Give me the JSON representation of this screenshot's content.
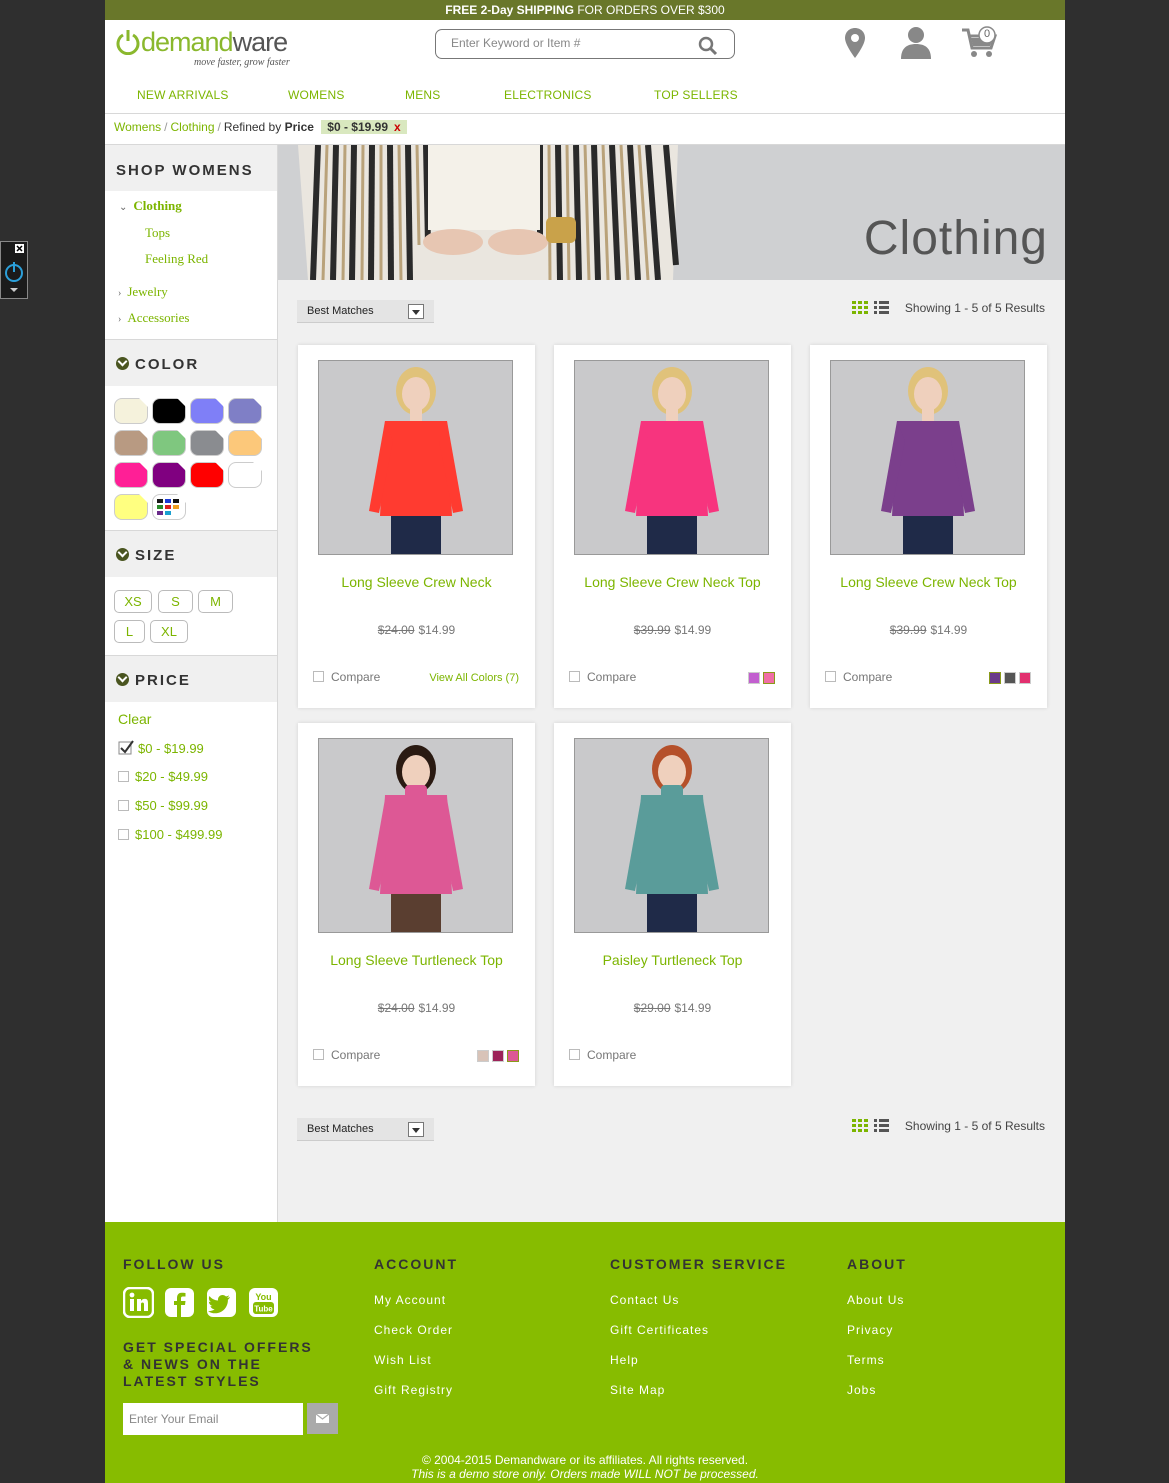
{
  "promo": {
    "bold": "FREE 2-Day SHIPPING",
    "rest": " FOR ORDERS OVER $300"
  },
  "logo": {
    "word_a": "demand",
    "word_b": "ware",
    "tagline": "move faster, grow faster"
  },
  "search": {
    "placeholder": "Enter Keyword or Item #"
  },
  "cart": {
    "count": "0"
  },
  "nav": [
    "NEW ARRIVALS",
    "WOMENS",
    "MENS",
    "ELECTRONICS",
    "TOP SELLERS"
  ],
  "breadcrumb": {
    "items": [
      "Womens",
      "Clothing"
    ],
    "refined_prefix": "Refined by",
    "refined_label": "Price",
    "chip": "$0 - $19.99",
    "chip_remove": "x"
  },
  "sidebar": {
    "shop_title": "SHOP WOMENS",
    "categories": [
      {
        "label": "Clothing",
        "expanded": true
      },
      {
        "label": "Tops"
      },
      {
        "label": "Feeling Red"
      },
      {
        "label": "Jewelry"
      },
      {
        "label": "Accessories"
      }
    ],
    "color_title": "COLOR",
    "colors": [
      "#f5f2dc",
      "#000000",
      "#7f7ff7",
      "#7f7fc6",
      "#b89a82",
      "#7fc77f",
      "#8a8c90",
      "#fcc87a",
      "#ff1f96",
      "#800080",
      "#ff0000",
      "#ffffff",
      "#ffff80",
      "multi"
    ],
    "size_title": "SIZE",
    "sizes": [
      "XS",
      "S",
      "M",
      "L",
      "XL"
    ],
    "price_title": "PRICE",
    "price_clear": "Clear",
    "prices": [
      {
        "label": "$0 - $19.99",
        "checked": true
      },
      {
        "label": "$20 - $49.99",
        "checked": false
      },
      {
        "label": "$50 - $99.99",
        "checked": false
      },
      {
        "label": "$100 - $499.99",
        "checked": false
      }
    ]
  },
  "banner": {
    "title": "Clothing"
  },
  "toolbar": {
    "sort": "Best Matches",
    "results": "Showing 1 - 5 of 5 Results"
  },
  "products": [
    {
      "name": "Long Sleeve Crew Neck",
      "old": "$24.00",
      "price": "$14.99",
      "compare": "Compare",
      "view_all": "View All Colors (7)",
      "swatches": [],
      "shirt": "#ff3b30"
    },
    {
      "name": "Long Sleeve Crew Neck Top",
      "old": "$39.99",
      "price": "$14.99",
      "compare": "Compare",
      "view_all": "",
      "swatches": [
        "#c25fcf",
        "#f06ea6"
      ],
      "shirt": "#f7347e"
    },
    {
      "name": "Long Sleeve Crew Neck Top",
      "old": "$39.99",
      "price": "$14.99",
      "compare": "Compare",
      "view_all": "",
      "swatches": [
        "#6b3b8a",
        "#555555",
        "#e2306f"
      ],
      "shirt": "#7b3f8c"
    },
    {
      "name": "Long Sleeve Turtleneck Top",
      "old": "$24.00",
      "price": "$14.99",
      "compare": "Compare",
      "view_all": "",
      "swatches": [
        "#d8c3b8",
        "#9c2358",
        "#dd5895"
      ],
      "shirt": "#dd5895"
    },
    {
      "name": "Paisley Turtleneck Top",
      "old": "$29.00",
      "price": "$14.99",
      "compare": "Compare",
      "view_all": "",
      "swatches": [],
      "shirt": "#5a9c9a"
    }
  ],
  "footer": {
    "follow": "FOLLOW US",
    "offers": "GET SPECIAL OFFERS & NEWS ON THE LATEST STYLES",
    "email_placeholder": "Enter Your Email",
    "account_title": "ACCOUNT",
    "account": [
      "My Account",
      "Check Order",
      "Wish List",
      "Gift Registry"
    ],
    "service_title": "CUSTOMER SERVICE",
    "service": [
      "Contact Us",
      "Gift Certificates",
      "Help",
      "Site Map"
    ],
    "about_title": "ABOUT",
    "about": [
      "About Us",
      "Privacy",
      "Terms",
      "Jobs"
    ],
    "copyright": "© 2004-2015 Demandware or its affiliates. All rights reserved.",
    "demo_note": "This is a demo store only. Orders made WILL NOT be processed."
  },
  "colors": {
    "accent": "#7cb500",
    "promo_bar": "#69772a",
    "footer": "#87bc00"
  }
}
